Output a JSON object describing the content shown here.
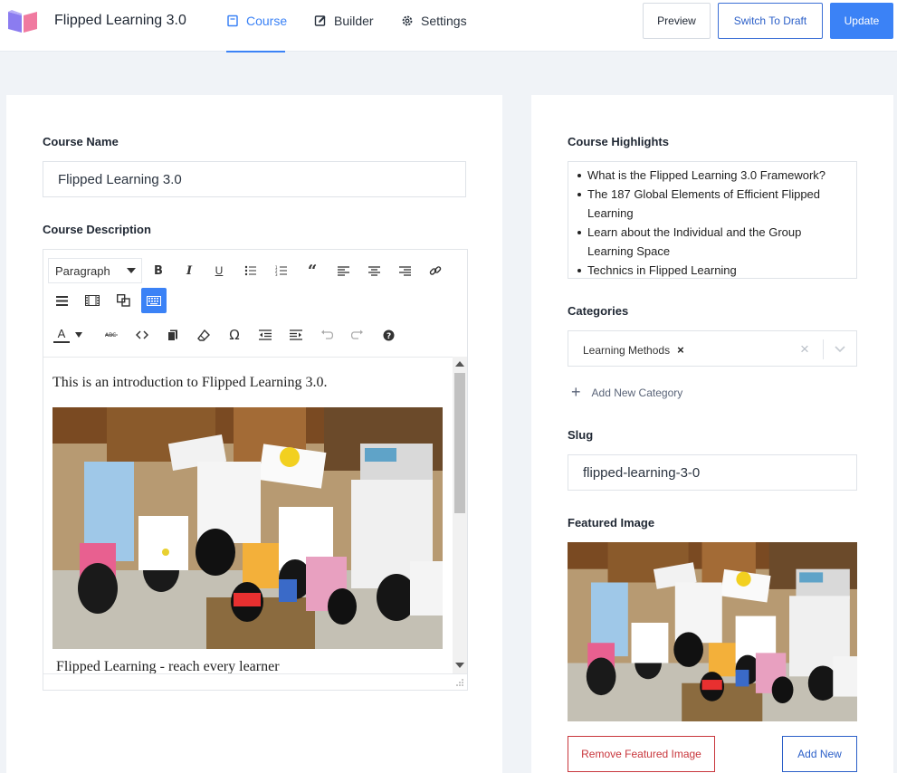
{
  "header": {
    "title": "Flipped Learning 3.0",
    "tabs": [
      {
        "label": "Course",
        "icon": "book-icon",
        "active": true
      },
      {
        "label": "Builder",
        "icon": "edit-icon",
        "active": false
      },
      {
        "label": "Settings",
        "icon": "gear-icon",
        "active": false
      }
    ],
    "buttons": {
      "preview": "Preview",
      "switch_draft": "Switch To Draft",
      "update": "Update"
    }
  },
  "course": {
    "name_label": "Course Name",
    "name_value": "Flipped Learning 3.0",
    "description_label": "Course Description",
    "editor": {
      "format_select": "Paragraph",
      "intro_text": "This is an introduction to Flipped Learning 3.0.",
      "caption_text": "Flipped Learning - reach every learner"
    }
  },
  "sidebar": {
    "highlights_label": "Course Highlights",
    "highlights": [
      "What is the Flipped Learning 3.0 Framework?",
      "The 187 Global Elements of Efficient Flipped Learning",
      "Learn about the Individual and the Group Learning Space",
      "Technics in Flipped Learning"
    ],
    "categories_label": "Categories",
    "categories": [
      "Learning Methods"
    ],
    "add_category": "Add New Category",
    "slug_label": "Slug",
    "slug_value": "flipped-learning-3-0",
    "featured_label": "Featured Image",
    "remove_image": "Remove Featured Image",
    "add_new": "Add New"
  },
  "colors": {
    "accent": "#3b82f6",
    "danger": "#c8363c",
    "background": "#f0f3f7"
  }
}
